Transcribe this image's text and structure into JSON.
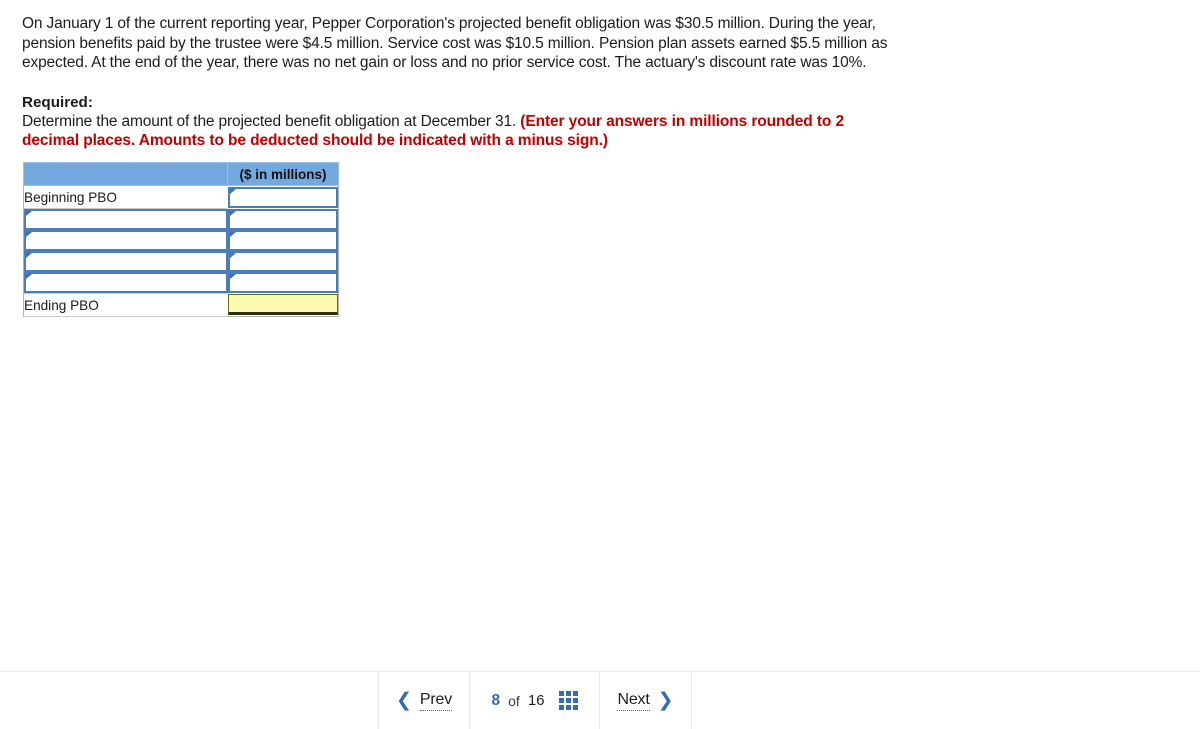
{
  "question": {
    "body": "On January 1 of the current reporting year, Pepper Corporation's projected benefit obligation was $30.5 million. During the year, pension benefits paid by the trustee were $4.5 million. Service cost was $10.5 million. Pension plan assets earned $5.5 million as expected. At the end of the year, there was no net gain or loss and no prior service cost. The actuary's discount rate was 10%."
  },
  "required": {
    "label": "Required:",
    "instruction": "Determine the amount of the projected benefit obligation at December 31. ",
    "note": "(Enter your answers in millions rounded to 2 decimal places. Amounts to be deducted should be indicated with a minus sign.)"
  },
  "answer_table": {
    "header": {
      "col1": "",
      "col2": "($ in millions)"
    },
    "rows": [
      {
        "type": "label",
        "label": "Beginning PBO",
        "value": "",
        "value_placeholder": ""
      },
      {
        "type": "input",
        "label": "",
        "label_placeholder": "",
        "value": "",
        "value_placeholder": ""
      },
      {
        "type": "input",
        "label": "",
        "label_placeholder": "",
        "value": "",
        "value_placeholder": ""
      },
      {
        "type": "input",
        "label": "",
        "label_placeholder": "",
        "value": "",
        "value_placeholder": ""
      },
      {
        "type": "input",
        "label": "",
        "label_placeholder": "",
        "value": "",
        "value_placeholder": ""
      },
      {
        "type": "total",
        "label": "Ending PBO",
        "value": "",
        "value_placeholder": ""
      }
    ]
  },
  "bottom_nav": {
    "prev_label": "Prev",
    "prev_icon": "chevron-left-icon",
    "page_current": "8",
    "page_of": "of",
    "page_total": "16",
    "grid_icon": "grid-menu-icon",
    "next_label": "Next",
    "next_icon": "chevron-right-icon"
  },
  "colors": {
    "header_blue": "#74a9e0",
    "input_border_blue": "#4a7ebb",
    "total_yellow": "#fbfaaf",
    "note_red": "#c20000",
    "accent_blue": "#2f6db5"
  }
}
